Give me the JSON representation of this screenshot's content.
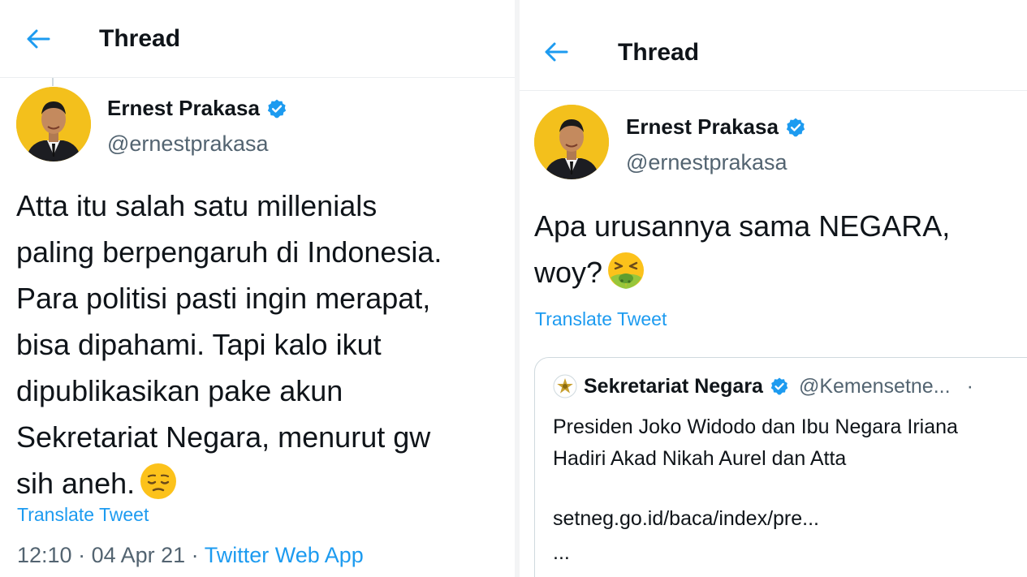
{
  "left": {
    "header": {
      "title": "Thread"
    },
    "tweet": {
      "name": "Ernest Prakasa",
      "handle": "@ernestprakasa",
      "text_lines": [
        "Atta itu salah satu millenials",
        "paling berpengaruh di Indonesia.",
        "Para politisi pasti ingin merapat,",
        "bisa dipahami. Tapi kalo ikut",
        "dipublikasikan pake akun",
        "Sekretariat Negara, menurut gw",
        "sih aneh."
      ],
      "emoji": "pensive-face",
      "translate": "Translate Tweet",
      "time": "12:10",
      "sep1": " · ",
      "date": "04 Apr 21",
      "sep2": " · ",
      "source": "Twitter Web App"
    }
  },
  "right": {
    "header": {
      "title": "Thread"
    },
    "tweet": {
      "name": "Ernest Prakasa",
      "handle": "@ernestprakasa",
      "text_lines": [
        "Apa urusannya sama NEGARA,",
        "woy?"
      ],
      "emoji": "nauseated-face",
      "translate": "Translate Tweet"
    },
    "quote": {
      "name": "Sekretariat Negara",
      "handle": "@Kemensetne...",
      "dot": "·",
      "text_lines": [
        "Presiden Joko Widodo dan Ibu Negara Iriana",
        "Hadiri Akad Nikah Aurel dan Atta"
      ],
      "link": "setneg.go.id/baca/index/pre...",
      "ellipsis": "..."
    }
  },
  "colors": {
    "accent": "#1d9bf0",
    "text": "#0f1419",
    "secondary": "#536471",
    "avatar_bg": "#f3c01c"
  }
}
